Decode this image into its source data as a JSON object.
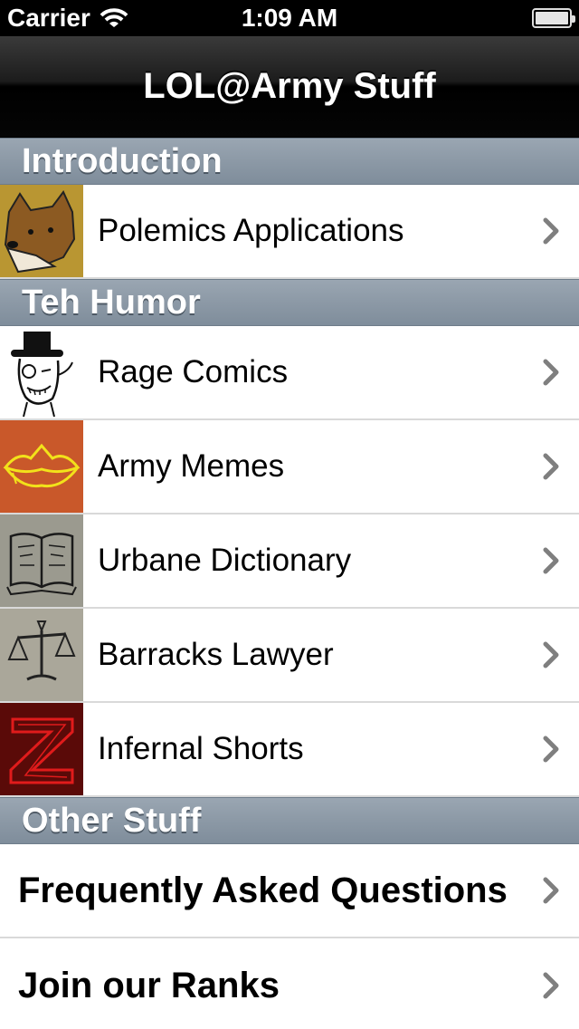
{
  "status_bar": {
    "carrier": "Carrier",
    "time": "1:09 AM"
  },
  "nav": {
    "title": "LOL@Army Stuff"
  },
  "sections": [
    {
      "header": "Introduction",
      "items": [
        {
          "label": "Polemics Applications",
          "icon": "bear-icon"
        }
      ]
    },
    {
      "header": "Teh Humor",
      "items": [
        {
          "label": "Rage Comics",
          "icon": "top-hat-meme-icon"
        },
        {
          "label": "Army Memes",
          "icon": "lips-icon"
        },
        {
          "label": "Urbane Dictionary",
          "icon": "book-icon"
        },
        {
          "label": "Barracks Lawyer",
          "icon": "scales-icon"
        },
        {
          "label": "Infernal Shorts",
          "icon": "z-letter-icon"
        }
      ]
    },
    {
      "header": "Other Stuff",
      "items": [
        {
          "label": "Frequently Asked Questions"
        },
        {
          "label": "Join our Ranks"
        }
      ]
    }
  ],
  "colors": {
    "section_header": "#8c99a6",
    "nav_bar": "#000000",
    "army_memes_bg": "#c9582a",
    "infernal_bg": "#5a0a08"
  }
}
